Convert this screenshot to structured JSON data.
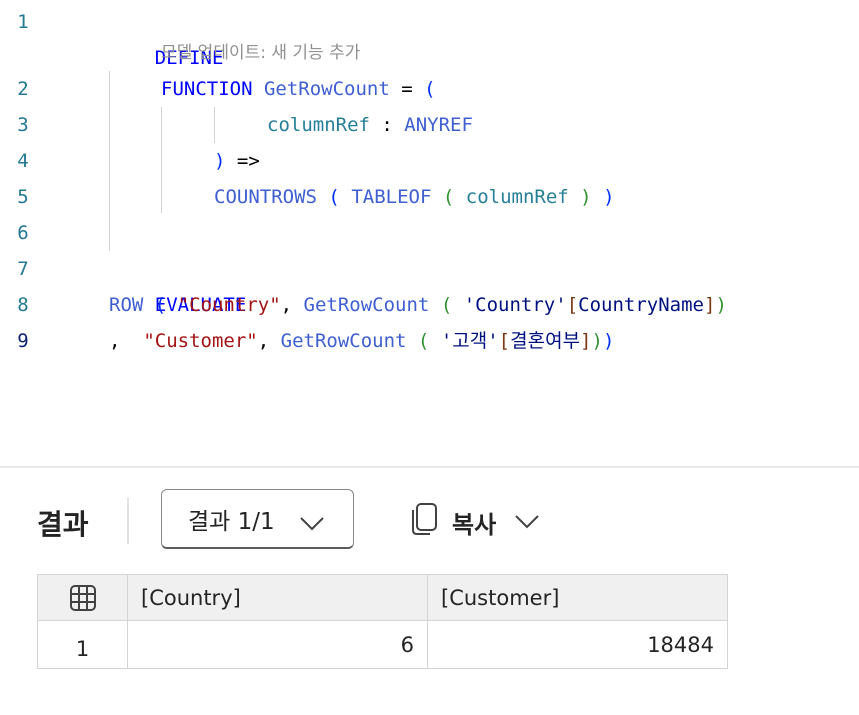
{
  "editor": {
    "line_numbers": [
      "1",
      "2",
      "3",
      "4",
      "5",
      "6",
      "7",
      "8",
      "9"
    ],
    "codelens": "모델 업데이트: 새 기능 추가",
    "lines": {
      "l1": {
        "define": "DEFINE"
      },
      "l2": {
        "function": "FUNCTION",
        "name": "GetRowCount",
        "eq": " = ",
        "open": "("
      },
      "l3": {
        "param": "columnRef",
        "colon": " : ",
        "type": "ANYREF"
      },
      "l4": {
        "close": ")",
        "arrow": " =>"
      },
      "l5": {
        "countrows": "COUNTROWS",
        "sp1": " ",
        "open1": "(",
        "sp2": " ",
        "tableof": "TABLEOF",
        "sp3": " ",
        "open2": "(",
        "sp4": " ",
        "param": "columnRef",
        "sp5": " ",
        "close2": ")",
        "sp6": " ",
        "close1": ")"
      },
      "l7": {
        "evaluate": "EVALUATE"
      },
      "l8": {
        "row": "ROW",
        "sp1": " ",
        "open1": "(",
        "sp2": " ",
        "str": "\"Country\"",
        "comma": ", ",
        "fn": "GetRowCount",
        "sp3": " ",
        "open2": "(",
        "sp4": " ",
        "tbl": "'Country'",
        "ob": "[",
        "col": "CountryName",
        "cb": "]",
        "close1": ")"
      },
      "l9": {
        "comma": ",",
        "sp1": "  ",
        "str": "\"Customer\"",
        "comma2": ", ",
        "fn": "GetRowCount",
        "sp2": " ",
        "open2": "(",
        "sp3": " ",
        "tbl": "'고객'",
        "ob": "[",
        "col": "결혼여부",
        "cb": "]",
        "close2": ")",
        "close1": ")"
      }
    }
  },
  "results": {
    "title": "결과",
    "select_label": "결과 1/1",
    "copy_label": "복사",
    "columns": [
      "[Country]",
      "[Customer]"
    ],
    "rows": [
      {
        "index": "1",
        "values": [
          "6",
          "18484"
        ]
      }
    ]
  },
  "icons": {
    "chevron": "chevron-down-icon",
    "copy": "copy-icon",
    "grid": "table-grid-icon"
  },
  "colors": {
    "keyword": "#0000ff",
    "function": "#3f5fd0",
    "string": "#a31515",
    "table": "#001080",
    "parameter": "#267f99",
    "line_number": "#237893"
  }
}
